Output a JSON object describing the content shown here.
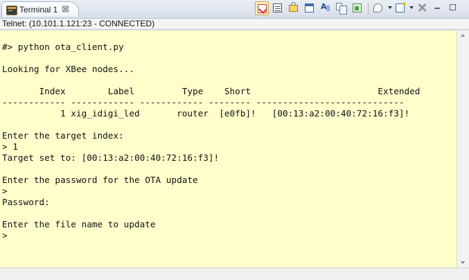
{
  "tab": {
    "title": "Terminal 1",
    "close_glyph": "⊠"
  },
  "toolbar": {
    "icons": [
      "connect-icon",
      "disconnect-icon",
      "lock-icon",
      "window-icon",
      "find-text-icon",
      "copy-icon",
      "export-icon",
      "pin-icon",
      "new-terminal-icon",
      "close-x-icon",
      "minimize-icon",
      "maximize-icon"
    ]
  },
  "status": {
    "text": "Telnet: (10.101.1.121:23 - CONNECTED)"
  },
  "terminal": {
    "background": "#ffffcc",
    "lines": [
      "",
      "#> python ota_client.py",
      "",
      "Looking for XBee nodes...",
      "",
      "       Index        Label         Type    Short                        Extended",
      "------------ ------------ ------------ -------- ----------------------------",
      "           1 xig_idigi_led       router  [e0fb]!   [00:13:a2:00:40:72:16:f3]!",
      "",
      "Enter the target index:",
      "> 1",
      "Target set to: [00:13:a2:00:40:72:16:f3]!",
      "",
      "Enter the password for the OTA update",
      ">",
      "Password:",
      "",
      "Enter the file name to update",
      ">"
    ]
  }
}
